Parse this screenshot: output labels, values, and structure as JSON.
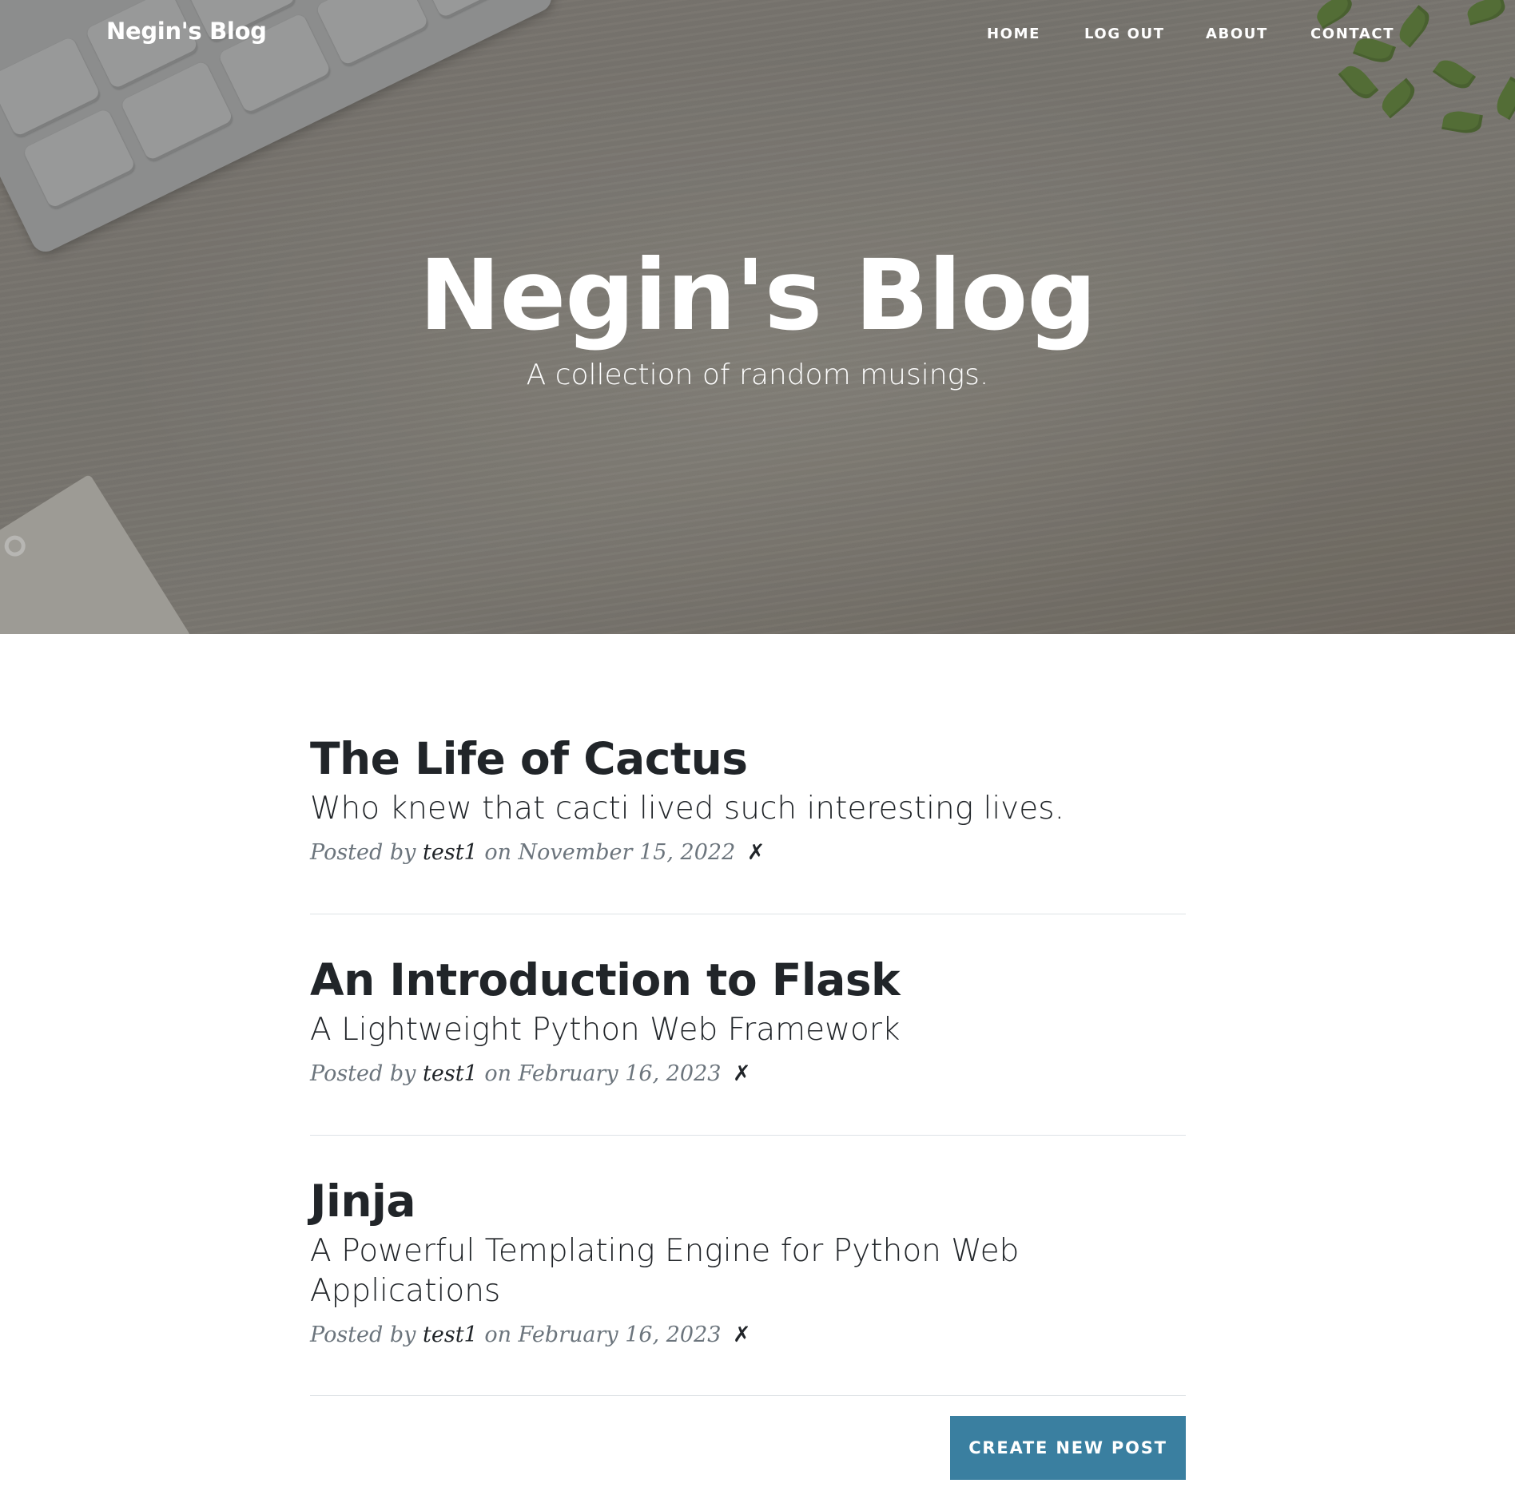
{
  "nav": {
    "brand": "Negin's Blog",
    "links": [
      {
        "label": "Home"
      },
      {
        "label": "Log Out"
      },
      {
        "label": "About"
      },
      {
        "label": "Contact"
      }
    ]
  },
  "hero": {
    "title": "Negin's Blog",
    "subtitle": "A collection of random musings."
  },
  "posts": [
    {
      "title": "The Life of Cactus",
      "subtitle": "Who knew that cacti lived such interesting lives.",
      "meta_prefix": "Posted by",
      "author": "test1",
      "date_text": "on November 15, 2022",
      "delete_label": "✗"
    },
    {
      "title": "An Introduction to Flask",
      "subtitle": "A Lightweight Python Web Framework",
      "meta_prefix": "Posted by",
      "author": "test1",
      "date_text": "on February 16, 2023",
      "delete_label": "✗"
    },
    {
      "title": "Jinja",
      "subtitle": "A Powerful Templating Engine for Python Web Applications",
      "meta_prefix": "Posted by",
      "author": "test1",
      "date_text": "on February 16, 2023",
      "delete_label": "✗"
    }
  ],
  "actions": {
    "create_post_label": "Create New Post"
  },
  "colors": {
    "accent": "#3a7fa0",
    "text": "#212529",
    "muted": "#6c757d"
  }
}
